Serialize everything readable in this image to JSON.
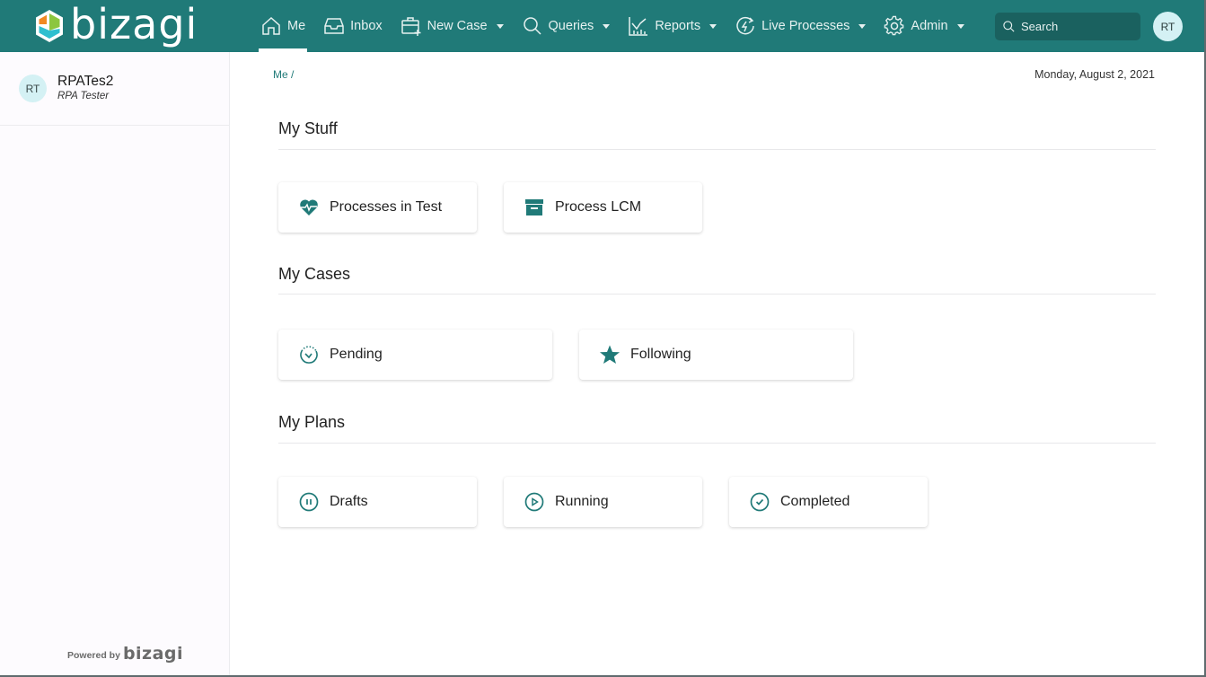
{
  "app": {
    "brand": "bizagi",
    "brand_colors": {
      "primary": "#207a78",
      "search_bg": "#1a615f",
      "avatar_bg": "#d4f1f4",
      "logo_orange": "#f08a24",
      "logo_green": "#8cc63f",
      "logo_blue": "#2fbfcf"
    }
  },
  "nav": {
    "items": [
      {
        "label": "Me",
        "icon": "home-icon",
        "active": true,
        "dropdown": false
      },
      {
        "label": "Inbox",
        "icon": "inbox-icon",
        "active": false,
        "dropdown": false
      },
      {
        "label": "New Case",
        "icon": "new-case-icon",
        "active": false,
        "dropdown": true
      },
      {
        "label": "Queries",
        "icon": "search-icon",
        "active": false,
        "dropdown": true
      },
      {
        "label": "Reports",
        "icon": "chart-icon",
        "active": false,
        "dropdown": true
      },
      {
        "label": "Live Processes",
        "icon": "live-process-icon",
        "active": false,
        "dropdown": true
      },
      {
        "label": "Admin",
        "icon": "gear-icon",
        "active": false,
        "dropdown": true
      }
    ],
    "search_placeholder": "Search",
    "avatar_initials": "RT"
  },
  "sidebar": {
    "user": {
      "initials": "RT",
      "name": "RPATes2",
      "role": "RPA Tester"
    },
    "powered_by": "Powered by",
    "powered_brand": "bizagi"
  },
  "main": {
    "breadcrumb": "Me /",
    "date": "Monday, August 2, 2021",
    "sections": [
      {
        "title": "My Stuff",
        "cards": [
          {
            "label": "Processes in Test",
            "icon": "heart-pulse-icon"
          },
          {
            "label": "Process LCM",
            "icon": "archive-icon"
          }
        ]
      },
      {
        "title": "My Cases",
        "cards": [
          {
            "label": "Pending",
            "icon": "timer-icon"
          },
          {
            "label": "Following",
            "icon": "star-icon"
          }
        ]
      },
      {
        "title": "My Plans",
        "cards": [
          {
            "label": "Drafts",
            "icon": "pause-circle-icon"
          },
          {
            "label": "Running",
            "icon": "play-circle-icon"
          },
          {
            "label": "Completed",
            "icon": "check-circle-icon"
          }
        ]
      }
    ]
  }
}
